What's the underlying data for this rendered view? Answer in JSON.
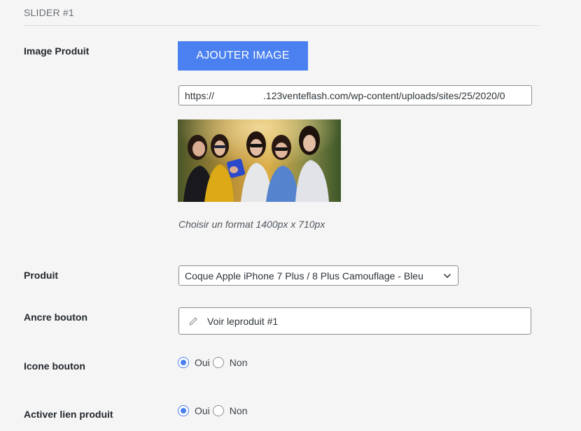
{
  "section": {
    "title": "SLIDER #1"
  },
  "image_field": {
    "label": "Image Produit",
    "button_label": "AJOUTER IMAGE",
    "url_prefix": "https://",
    "url_suffix": ".123venteflash.com/wp-content/uploads/sites/25/2020/0",
    "hint": "Choisir un format 1400px x 710px"
  },
  "product_field": {
    "label": "Produit",
    "selected": "Coque Apple iPhone 7 Plus / 8 Plus Camouflage - Bleu"
  },
  "anchor_field": {
    "label": "Ancre bouton",
    "value": "Voir leproduit #1"
  },
  "icon_field": {
    "label": "Icone bouton",
    "options": [
      {
        "label": "Oui",
        "checked": true
      },
      {
        "label": "Non",
        "checked": false
      }
    ]
  },
  "link_field": {
    "label": "Activer lien produit",
    "options": [
      {
        "label": "Oui",
        "checked": true
      },
      {
        "label": "Non",
        "checked": false
      }
    ]
  },
  "colors": {
    "accent": "#4a80f0",
    "label": "#23282d",
    "hint": "#50575e"
  }
}
